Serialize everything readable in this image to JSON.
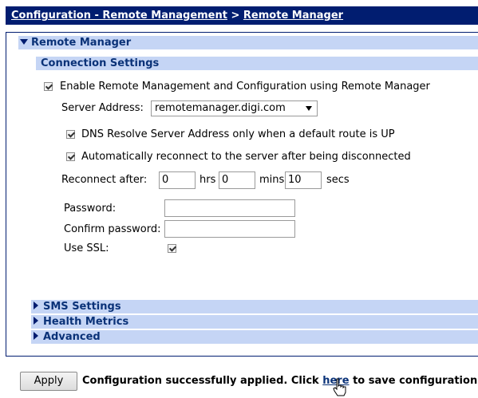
{
  "breadcrumb": {
    "part1": "Configuration - Remote Management",
    "separator": " > ",
    "part2": "Remote Manager"
  },
  "main_section": {
    "title": "Remote Manager",
    "expanded": true
  },
  "connection": {
    "title": "Connection Settings",
    "enable_label": "Enable Remote Management and Configuration using Remote Manager",
    "enable_checked": true,
    "server_label": "Server Address:",
    "server_value": "remotemanager.digi.com",
    "dns_label": "DNS Resolve Server Address only when a default route is UP",
    "dns_checked": true,
    "reconnect_auto_label": "Automatically reconnect to the server after being disconnected",
    "reconnect_auto_checked": true,
    "reconnect_after_label": "Reconnect after:",
    "hrs_value": "0",
    "hrs_label": "hrs",
    "mins_value": "0",
    "mins_label": "mins",
    "secs_value": "10",
    "secs_label": "secs",
    "password_label": "Password:",
    "confirm_label": "Confirm password:",
    "ssl_label": "Use SSL:",
    "ssl_checked": true
  },
  "collapsed_sections": [
    "SMS Settings",
    "Health Metrics",
    "Advanced"
  ],
  "footer": {
    "apply_label": "Apply",
    "status_prefix": "Configuration successfully applied. Click ",
    "here_link": "here",
    "status_suffix": " to save configuration."
  },
  "colors": {
    "titlebar": "#011d70",
    "section_bg": "#c5d5f5",
    "section_text": "#0a3278"
  },
  "icons": [
    "triangle-down-icon",
    "triangle-right-icon",
    "checkbox-checked-icon",
    "hand-pointer-cursor-icon"
  ]
}
